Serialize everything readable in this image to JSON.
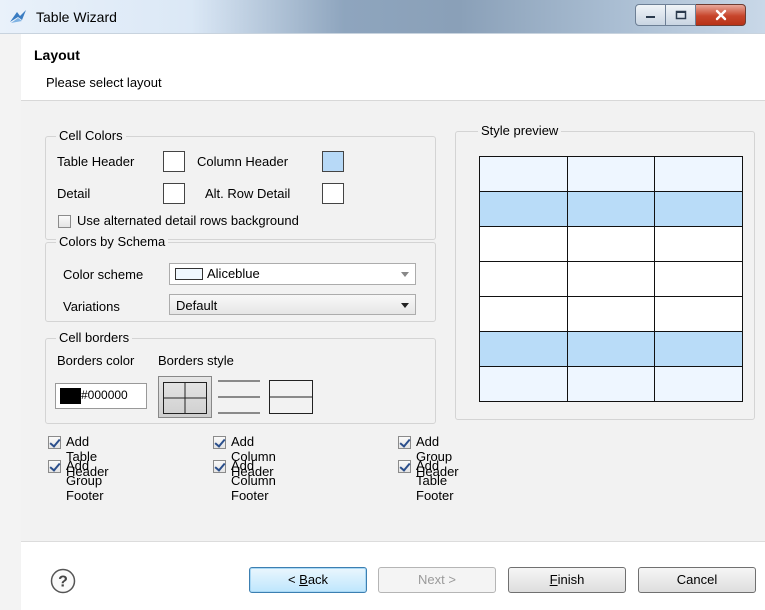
{
  "window": {
    "title": "Table Wizard"
  },
  "header": {
    "heading": "Layout",
    "subtitle": "Please select layout"
  },
  "cell_colors": {
    "legend": "Cell Colors",
    "table_header_label": "Table Header",
    "column_header_label": "Column Header",
    "detail_label": "Detail",
    "alt_row_detail_label": "Alt. Row Detail",
    "table_header_color": "#ffffff",
    "column_header_color": "#b7d9f7",
    "detail_color": "#ffffff",
    "alt_row_detail_color": "#ffffff",
    "use_alternated_label": "Use alternated detail rows background",
    "use_alternated_checked": false
  },
  "schema": {
    "legend": "Colors by Schema",
    "color_scheme_label": "Color scheme",
    "color_scheme_value": "Aliceblue",
    "color_scheme_swatch": "#f0f8ff",
    "variations_label": "Variations",
    "variations_value": "Default"
  },
  "borders": {
    "legend": "Cell borders",
    "color_label": "Borders color",
    "style_label": "Borders style",
    "color_value": "#000000"
  },
  "preview": {
    "legend": "Style preview",
    "rows": [
      "#eef6ff",
      "#b9dcf8",
      "#ffffff",
      "#ffffff",
      "#ffffff",
      "#b9dcf8",
      "#eef6ff"
    ]
  },
  "options": [
    {
      "label": "Add Table Header",
      "checked": true
    },
    {
      "label": "Add Column Header",
      "checked": true
    },
    {
      "label": "Add Group Header",
      "checked": true
    },
    {
      "label": "Add Group Footer",
      "checked": true
    },
    {
      "label": "Add Column Footer",
      "checked": true
    },
    {
      "label": "Add Table Footer",
      "checked": true
    }
  ],
  "buttons": {
    "back_prefix": "< ",
    "back_mnemonic": "B",
    "back_rest": "ack",
    "next": "Next >",
    "finish_mnemonic": "F",
    "finish_rest": "inish",
    "cancel": "Cancel"
  }
}
